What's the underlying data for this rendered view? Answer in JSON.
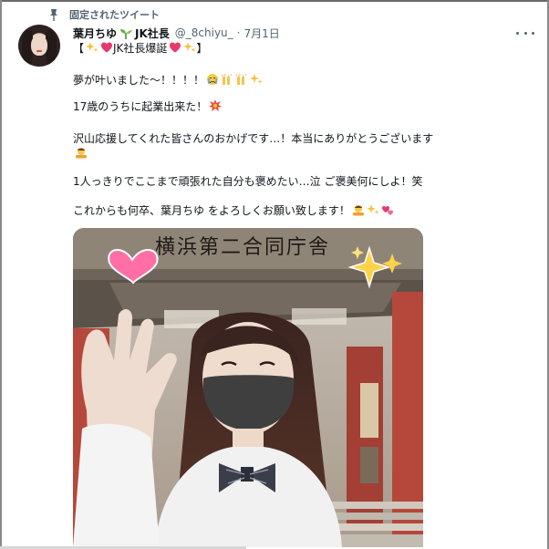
{
  "pinned_label": "固定されたツイート",
  "tweet": {
    "author_name_part1": "葉月ちゆ",
    "author_name_part2": "JK社長",
    "handle": "@_8chiyu_",
    "separator": "·",
    "date": "7月1日",
    "lines": [
      "【",
      "JK社長爆誕",
      "】",
      "夢が叶いました〜！！！！",
      "17歳のうちに起業出来た！",
      "沢山応援してくれた皆さんのおかげです…！本当にありがとうございます",
      "1人っきりでここまで頑張れた自分も褒めたい…泣 ご褒美何にしよ！笑",
      "これからも何卒、葉月ちゆ をよろしくお願い致します！"
    ]
  },
  "media": {
    "building_sign": "横浜第二合同庁舎"
  },
  "icons": {
    "pin": "pin-icon",
    "sprout": "sprout-icon",
    "more": "more-icon",
    "sparkles": "sparkles-icon",
    "heart": "heart-icon",
    "crying_face": "crying-face-icon",
    "raised_hands": "raised-hands-icon",
    "collision": "collision-icon",
    "bowing_person": "bowing-person-icon",
    "two_hearts": "two-hearts-icon"
  },
  "colors": {
    "text_primary": "#0f1419",
    "text_secondary": "#536471",
    "brick": "#b6483b",
    "heart_pink": "#e6396d",
    "sparkle_gold": "#f6c13a"
  }
}
